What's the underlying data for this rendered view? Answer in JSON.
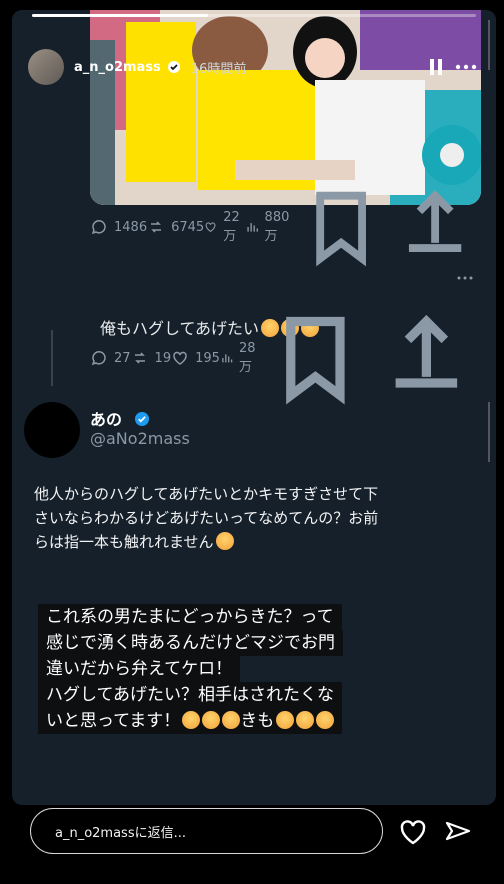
{
  "header": {
    "username": "a_n_o2mass",
    "time": "16時間前"
  },
  "tweet1": {
    "replies": "1486",
    "reposts": "6745",
    "likes": "22万",
    "views": "880万"
  },
  "reply": {
    "text": "俺もハグしてあげたい"
  },
  "tweet2": {
    "replies": "27",
    "reposts": "19",
    "likes": "195",
    "views": "28万"
  },
  "post": {
    "display_name": "あの",
    "handle": "@aNo2mass",
    "body_lines": [
      "他人からのハグしてあげたいとかキモすぎさせて下",
      "さいならわかるけどあげたいってなめてんの？お前",
      "らは指一本も触れれません"
    ]
  },
  "caption": {
    "lines": [
      "これ系の男たまにどっからきた？って",
      "感じで湧く時あるんだけどマジでお門",
      "違いだから弁えてケロ！",
      "ハグしてあげたい？相手はされたくな",
      "いと思ってます！",
      "きも"
    ]
  },
  "bottom": {
    "reply_placeholder": "a_n_o2massに返信..."
  },
  "colors": {
    "verified": "#1d9bf0",
    "story_bg": "#15202b"
  }
}
